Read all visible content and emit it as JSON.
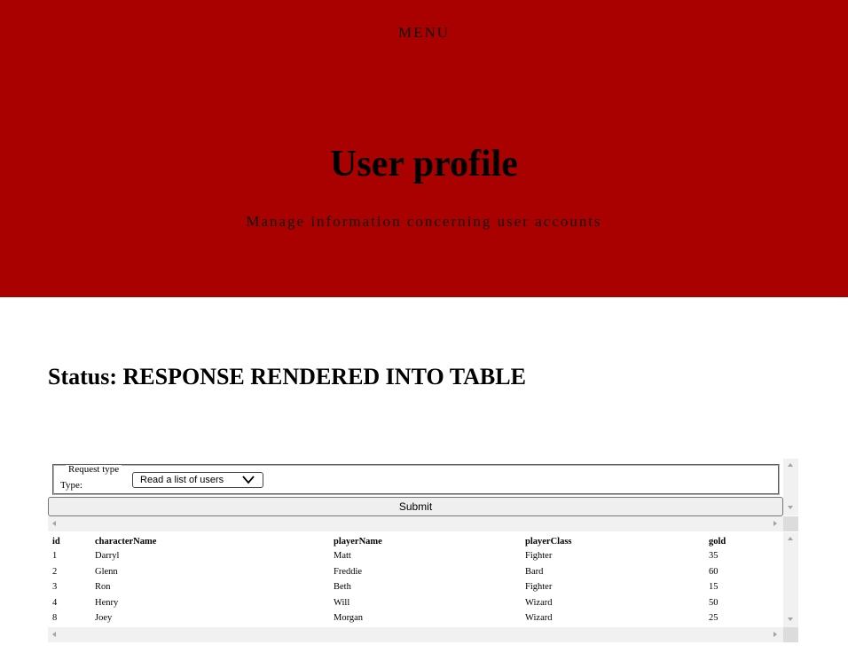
{
  "header": {
    "menu_label": "MENU",
    "title": "User profile",
    "subtitle": "Manage information concerning user accounts"
  },
  "status": {
    "text": "Status: RESPONSE RENDERED INTO TABLE"
  },
  "form": {
    "legend": "Request type",
    "type_label": "Type:",
    "select_value": "Read a list of users",
    "submit_label": "Submit"
  },
  "table": {
    "columns": [
      "id",
      "characterName",
      "playerName",
      "playerClass",
      "gold"
    ],
    "rows": [
      [
        "1",
        "Darryl",
        "Matt",
        "Fighter",
        "35"
      ],
      [
        "2",
        "Glenn",
        "Freddie",
        "Bard",
        "60"
      ],
      [
        "3",
        "Ron",
        "Beth",
        "Fighter",
        "15"
      ],
      [
        "4",
        "Henry",
        "Will",
        "Wizard",
        "50"
      ],
      [
        "8",
        "Joey",
        "Morgan",
        "Wizard",
        "25"
      ]
    ]
  },
  "colors": {
    "hero_background": "#a90000",
    "page_background": "#ffffff"
  },
  "icons": {
    "select_chevron": "chevron-down-icon"
  }
}
